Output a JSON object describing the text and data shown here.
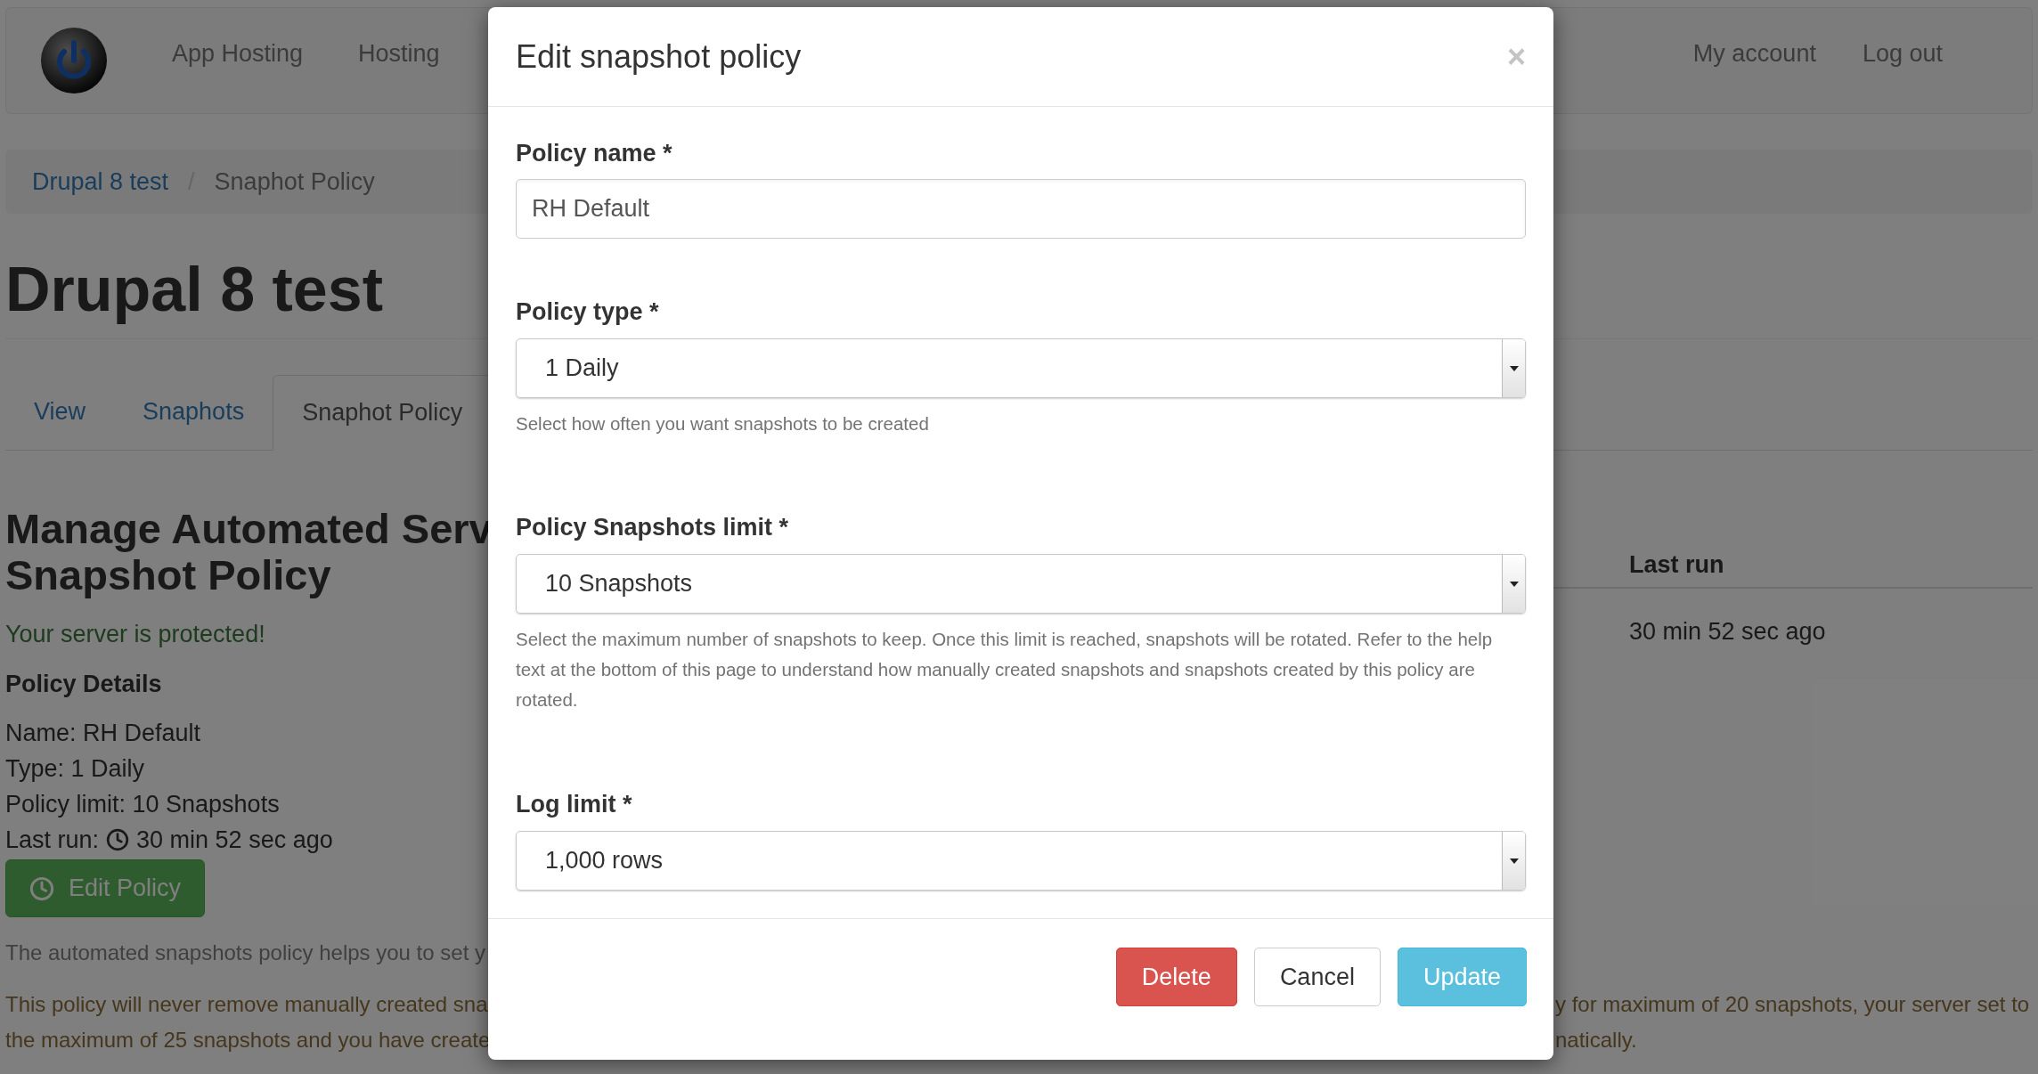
{
  "navbar": {
    "links": [
      "App Hosting",
      "Hosting"
    ],
    "right_links": [
      "My account",
      "Log out"
    ]
  },
  "breadcrumb": {
    "separator": "/",
    "items": [
      {
        "label": "Drupal 8 test",
        "kind": "link"
      },
      {
        "label": "Snaphot Policy",
        "kind": "current"
      }
    ]
  },
  "title": "Drupal 8 test",
  "tabs": [
    {
      "label": "View",
      "selected": false
    },
    {
      "label": "Snaphots",
      "selected": false
    },
    {
      "label": "Snaphot Policy",
      "selected": true
    }
  ],
  "policy": {
    "heading_lines": [
      "Manage Automated Serv",
      "Snapshot Policy"
    ],
    "status": "Your server is protected!",
    "details_title": "Policy Details",
    "details": [
      "Name: RH Default",
      "Type: 1 Daily",
      "Policy limit: 10 Snapshots"
    ],
    "last_run_label": "Last run:",
    "last_run_value": "30 min 52 sec ago",
    "edit_button": "Edit Policy"
  },
  "table": {
    "columns": [
      "Last run"
    ],
    "rows": [
      [
        "30 min 52 sec ago"
      ]
    ]
  },
  "paragraphs": [
    {
      "kind": "muted",
      "left": [
        "The automated snapshots policy helps you to set y"
      ]
    },
    {
      "kind": "warning",
      "left": [
        "This policy will never remove manually created sna",
        "the maximum of 25 snapshots and you have create"
      ],
      "right": [
        "y for maximum of 20 snapshots, your server set to",
        "natically."
      ]
    }
  ],
  "modal": {
    "title": "Edit snapshot policy",
    "close": "×",
    "fields": [
      {
        "label": "Policy name *",
        "kind": "text",
        "value": "RH Default"
      },
      {
        "label": "Policy type *",
        "kind": "select",
        "value": "1 Daily",
        "help": "Select how often you want snapshots to be created"
      },
      {
        "label": "Policy Snapshots limit *",
        "kind": "select",
        "value": "10 Snapshots",
        "help": "Select the maximum number of snapshots to keep. Once this limit is reached, snapshots will be rotated. Refer to the help text at the bottom of this page to understand how manually created snapshots and snapshots created by this policy are rotated."
      },
      {
        "label": "Log limit *",
        "kind": "select",
        "value": "1,000 rows"
      }
    ],
    "buttons": [
      {
        "label": "Delete",
        "kind": "danger"
      },
      {
        "label": "Cancel",
        "kind": "default"
      },
      {
        "label": "Update",
        "kind": "info"
      }
    ]
  }
}
